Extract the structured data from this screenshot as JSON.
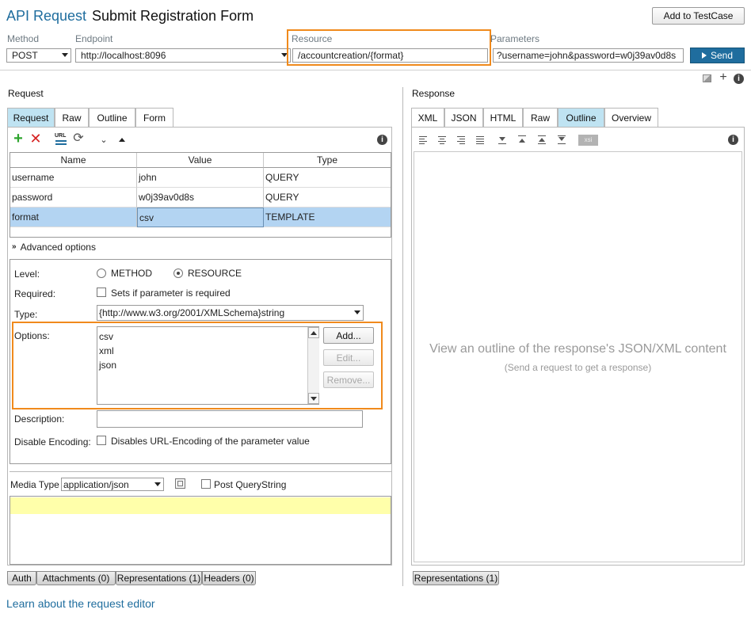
{
  "header": {
    "api_label": "API Request",
    "title": "Submit Registration Form",
    "add_testcase_label": "Add to TestCase"
  },
  "request_line": {
    "method_label": "Method",
    "method_value": "POST",
    "endpoint_label": "Endpoint",
    "endpoint_value": "http://localhost:8096",
    "resource_label": "Resource",
    "resource_value": "/accountcreation/{format}",
    "parameters_label": "Parameters",
    "parameters_value": "?username=john&password=w0j39av0d8s",
    "send_label": "Send"
  },
  "request_panel": {
    "title": "Request",
    "tabs": [
      "Request",
      "Raw",
      "Outline",
      "Form"
    ],
    "active_tab": "Request",
    "table": {
      "columns": [
        "Name",
        "Value",
        "Type"
      ],
      "rows": [
        {
          "name": "username",
          "value": "john",
          "type": "QUERY"
        },
        {
          "name": "password",
          "value": "w0j39av0d8s",
          "type": "QUERY"
        },
        {
          "name": "format",
          "value": "csv",
          "type": "TEMPLATE"
        }
      ]
    },
    "advanced": {
      "toggle_label": "Advanced options",
      "level_label": "Level:",
      "level_method": "METHOD",
      "level_resource": "RESOURCE",
      "level_selected": "RESOURCE",
      "required_label": "Required:",
      "required_text": "Sets if parameter is required",
      "type_label": "Type:",
      "type_value": "{http://www.w3.org/2001/XMLSchema}string",
      "options_label": "Options:",
      "options": [
        "csv",
        "xml",
        "json"
      ],
      "add_label": "Add...",
      "edit_label": "Edit...",
      "remove_label": "Remove...",
      "description_label": "Description:",
      "disable_encoding_label": "Disable Encoding:",
      "disable_encoding_text": "Disables URL-Encoding of the parameter value"
    },
    "media": {
      "label": "Media Type",
      "value": "application/json",
      "post_querystring_label": "Post QueryString"
    },
    "bottom_tabs": [
      "Auth",
      "Attachments (0)",
      "Representations (1)",
      "Headers (0)"
    ]
  },
  "response_panel": {
    "title": "Response",
    "tabs": [
      "XML",
      "JSON",
      "HTML",
      "Raw",
      "Outline",
      "Overview"
    ],
    "active_tab": "Outline",
    "empty_main": "View an outline of the response's JSON/XML content",
    "empty_sub": "(Send a request to get a response)",
    "bottom_tabs": [
      "Representations (1)"
    ],
    "xsi_label": "xsi"
  },
  "footer": {
    "link": "Learn about the request editor"
  },
  "colors": {
    "accent": "#1f6d9e",
    "highlight": "#f08a1c",
    "active_tab": "#bfe3f2",
    "selected_row": "#b3d4f2",
    "media_body": "#ffffaa"
  }
}
